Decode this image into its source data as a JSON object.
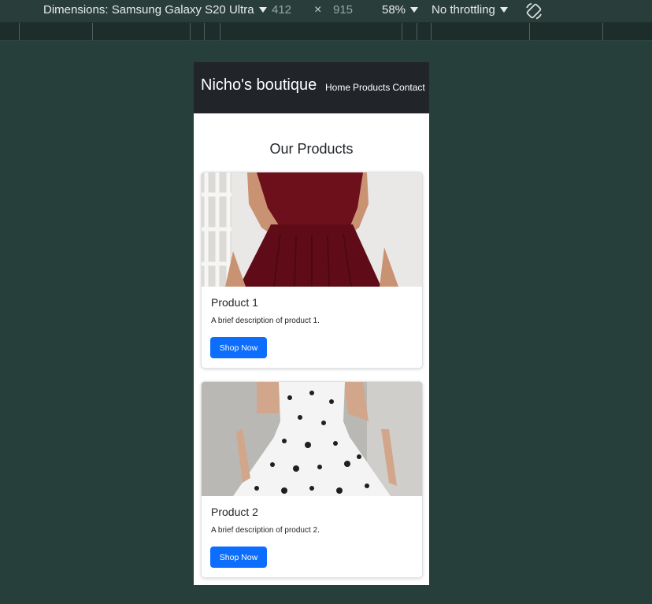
{
  "devtools": {
    "dimensions_label": "Dimensions: Samsung Galaxy S20 Ultra",
    "width": "412",
    "times": "×",
    "height": "915",
    "zoom": "58%",
    "throttling": "No throttling",
    "rotate_icon": "rotate-icon"
  },
  "site": {
    "brand": "Nicho's boutique",
    "nav": [
      {
        "label": "Home"
      },
      {
        "label": "Products"
      },
      {
        "label": "Contact"
      }
    ],
    "section_title": "Our Products",
    "products": [
      {
        "title": "Product 1",
        "description": "A brief description of product 1.",
        "button": "Shop Now",
        "dress_color": "#6e0f1c"
      },
      {
        "title": "Product 2",
        "description": "A brief description of product 2.",
        "button": "Shop Now",
        "dress_color": "#f4f4f4"
      }
    ]
  },
  "colors": {
    "navbar_bg": "#212529",
    "button_bg": "#0d6efd",
    "devtools_bg": "#263f3b"
  }
}
